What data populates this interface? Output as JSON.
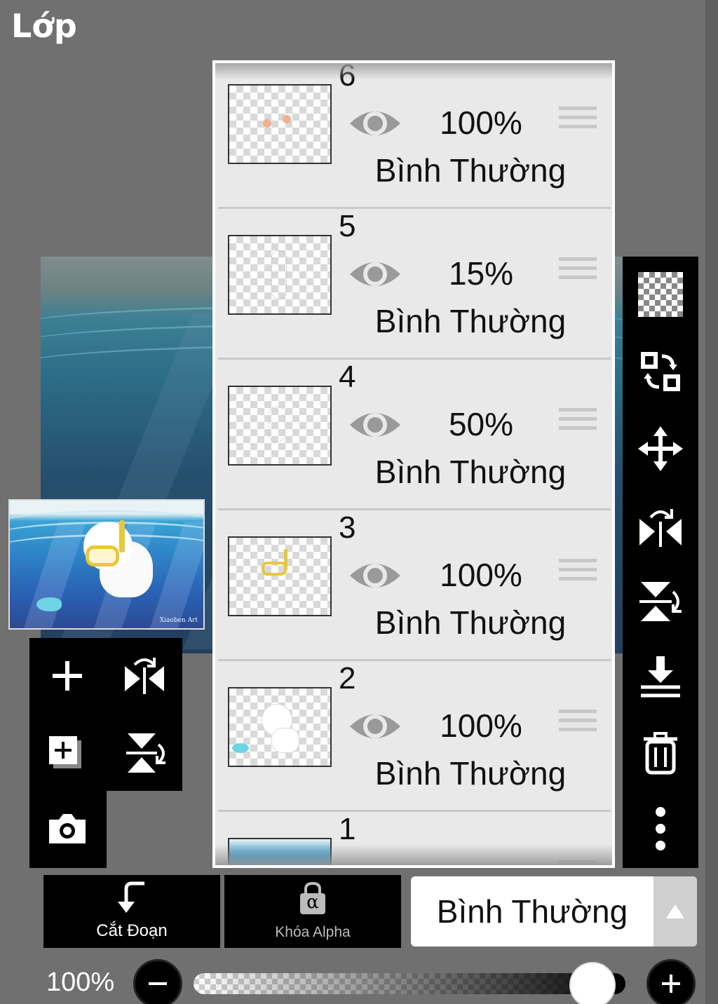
{
  "app": {
    "title": "Lớp"
  },
  "layers": [
    {
      "num": "6",
      "opacity": "100%",
      "blend": "Bình Thường"
    },
    {
      "num": "5",
      "opacity": "15%",
      "blend": "Bình Thường"
    },
    {
      "num": "4",
      "opacity": "50%",
      "blend": "Bình Thường"
    },
    {
      "num": "3",
      "opacity": "100%",
      "blend": "Bình Thường"
    },
    {
      "num": "2",
      "opacity": "100%",
      "blend": "Bình Thường"
    },
    {
      "num": "1"
    }
  ],
  "bottom": {
    "clip_label": "Cắt Đoạn",
    "alpha_lock_label": "Khóa Alpha",
    "alpha_symbol": "α",
    "blend_mode": "Bình Thường",
    "opacity_value": "100%",
    "opacity_fraction": 1.0
  },
  "preview": {
    "signature": "Xiaoben Art"
  },
  "icons": {
    "left_tools": [
      "plus-icon",
      "flip-horizontal-icon",
      "add-layer-icon",
      "flip-vertical-icon",
      "camera-icon"
    ],
    "right_tools": [
      "transparent-icon",
      "swap-icon",
      "move-icon",
      "flip-horizontal-icon",
      "flip-vertical-icon",
      "merge-down-icon",
      "trash-icon",
      "more-icon"
    ]
  },
  "colors": {
    "panel_bg": "#e9e9e9",
    "toolbar_bg": "#000000",
    "app_bg": "#707070"
  }
}
